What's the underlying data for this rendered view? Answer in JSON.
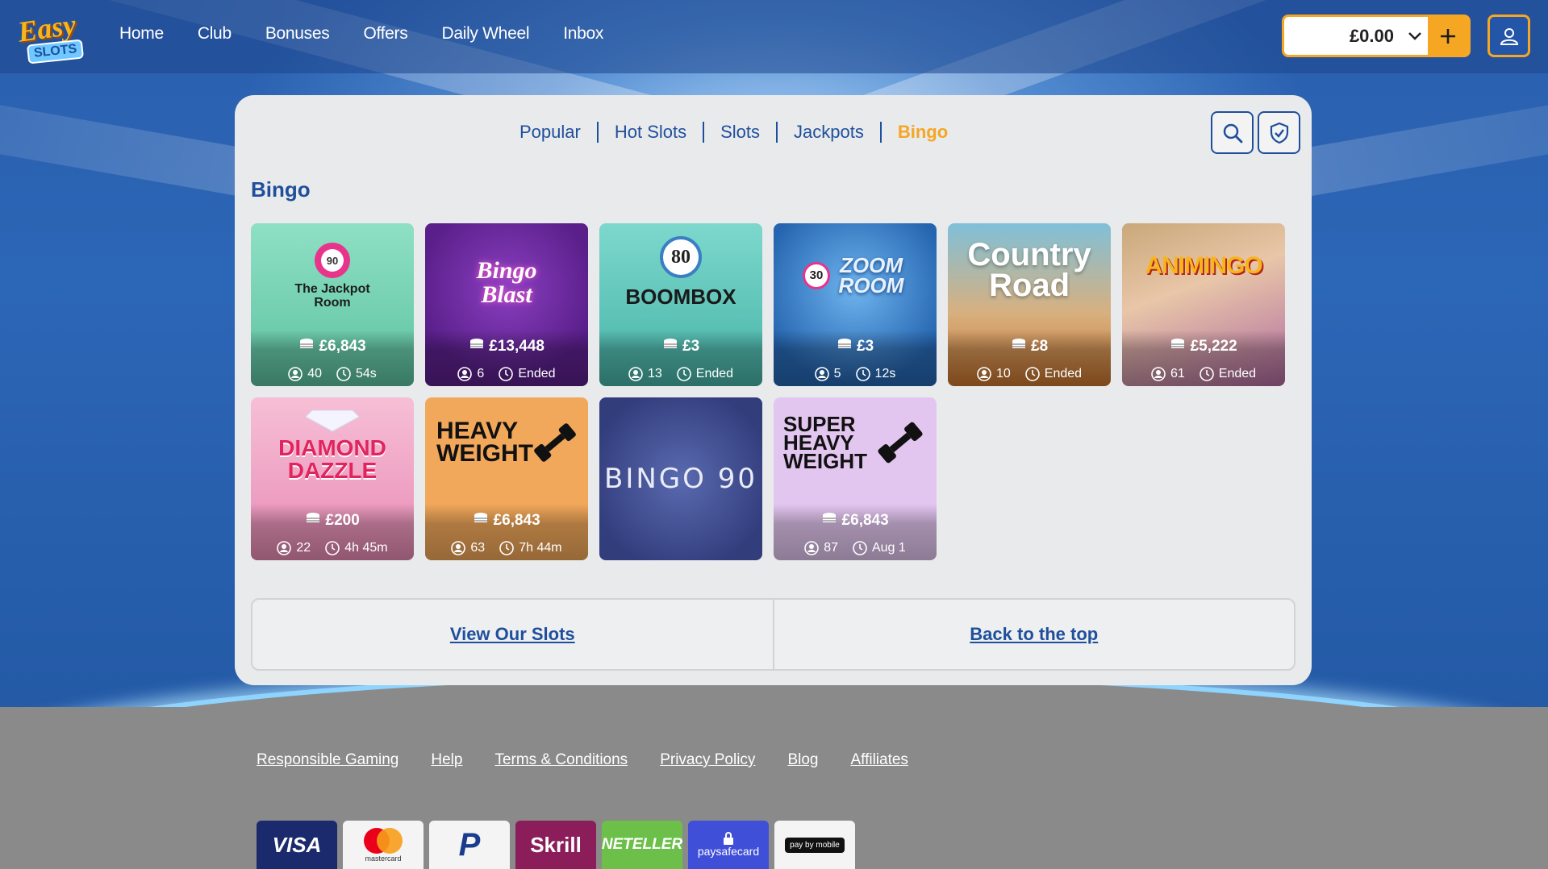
{
  "header": {
    "logo_top": "Easy",
    "logo_bottom": "SLOTS",
    "nav": [
      "Home",
      "Club",
      "Bonuses",
      "Offers",
      "Daily Wheel",
      "Inbox"
    ],
    "balance": "£0.00"
  },
  "tabs": [
    "Popular",
    "Hot Slots",
    "Slots",
    "Jackpots",
    "Bingo"
  ],
  "active_tab": "Bingo",
  "section_title": "Bingo",
  "games": [
    {
      "title": "The Jackpot Room",
      "ball": "90",
      "prize": "£6,843",
      "players": "40",
      "time": "54s"
    },
    {
      "title": "Bingo Blast",
      "prize": "£13,448",
      "players": "6",
      "time": "Ended"
    },
    {
      "title": "BOOMBOX",
      "ball": "80",
      "prize": "£3",
      "players": "13",
      "time": "Ended"
    },
    {
      "title": "ZOOM ROOM",
      "ball": "30",
      "prize": "£3",
      "players": "5",
      "time": "12s"
    },
    {
      "title": "Country Road",
      "prize": "£8",
      "players": "10",
      "time": "Ended"
    },
    {
      "title": "ANIMINGO",
      "prize": "£5,222",
      "players": "61",
      "time": "Ended"
    },
    {
      "title": "DIAMOND DAZZLE",
      "prize": "£200",
      "players": "22",
      "time": "4h 45m"
    },
    {
      "title": "HEAVY WEIGHT",
      "prize": "£6,843",
      "players": "63",
      "time": "7h 44m"
    },
    {
      "title": "BINGO 90"
    },
    {
      "title": "SUPER HEAVY WEIGHT",
      "prize": "£6,843",
      "players": "87",
      "time": "Aug 1"
    }
  ],
  "bottom_links": {
    "left": "View Our Slots",
    "right": "Back to the top"
  },
  "footer_links": [
    "Responsible Gaming",
    "Help",
    "Terms & Conditions",
    "Privacy Policy",
    "Blog",
    "Affiliates"
  ],
  "payments": [
    "VISA",
    "mastercard",
    "P",
    "Skrill",
    "NETELLER",
    "paysafecard",
    "pay by mobile"
  ],
  "colors": {
    "brand_blue": "#1f4f9c",
    "accent_orange": "#f5a623"
  }
}
